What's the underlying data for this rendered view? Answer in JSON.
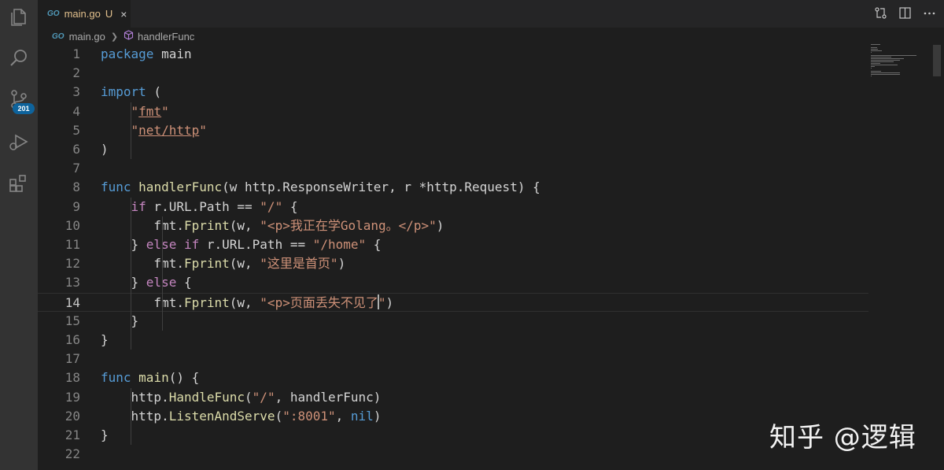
{
  "tab": {
    "icon_text": "GO",
    "title": "main.go",
    "status": "U",
    "close": "×"
  },
  "breadcrumb": {
    "icon_text": "GO",
    "file": "main.go",
    "symbol": "handlerFunc"
  },
  "activity": {
    "scm_badge": "201"
  },
  "colors": {
    "background": "#1e1e1e",
    "activity_bar": "#333333",
    "keyword": "#569cd6",
    "control": "#c586c0",
    "function": "#dcdcaa",
    "string": "#ce9178"
  },
  "editor": {
    "current_line": 14,
    "lines": [
      {
        "n": "1",
        "tokens": [
          {
            "t": "package",
            "c": "kw"
          },
          {
            "t": " main",
            "c": "plain"
          }
        ]
      },
      {
        "n": "2",
        "tokens": []
      },
      {
        "n": "3",
        "tokens": [
          {
            "t": "import",
            "c": "kw"
          },
          {
            "t": " (",
            "c": "plain"
          }
        ]
      },
      {
        "n": "4",
        "tokens": [
          {
            "t": "    ",
            "c": "plain"
          },
          {
            "t": "\"",
            "c": "str"
          },
          {
            "t": "fmt",
            "c": "str ul"
          },
          {
            "t": "\"",
            "c": "str"
          }
        ]
      },
      {
        "n": "5",
        "tokens": [
          {
            "t": "    ",
            "c": "plain"
          },
          {
            "t": "\"",
            "c": "str"
          },
          {
            "t": "net/http",
            "c": "str ul"
          },
          {
            "t": "\"",
            "c": "str"
          }
        ]
      },
      {
        "n": "6",
        "tokens": [
          {
            "t": ")",
            "c": "plain"
          }
        ]
      },
      {
        "n": "7",
        "tokens": []
      },
      {
        "n": "8",
        "tokens": [
          {
            "t": "func",
            "c": "kw"
          },
          {
            "t": " ",
            "c": "plain"
          },
          {
            "t": "handlerFunc",
            "c": "fn"
          },
          {
            "t": "(w http.ResponseWriter, r *http.Request) {",
            "c": "plain"
          }
        ]
      },
      {
        "n": "9",
        "tokens": [
          {
            "t": "    ",
            "c": "plain"
          },
          {
            "t": "if",
            "c": "ctl"
          },
          {
            "t": " r.URL.Path == ",
            "c": "plain"
          },
          {
            "t": "\"/\"",
            "c": "str"
          },
          {
            "t": " {",
            "c": "plain"
          }
        ]
      },
      {
        "n": "10",
        "tokens": [
          {
            "t": "       fmt.",
            "c": "plain"
          },
          {
            "t": "Fprint",
            "c": "fn"
          },
          {
            "t": "(w, ",
            "c": "plain"
          },
          {
            "t": "\"<p>我正在学Golang。</p>\"",
            "c": "str"
          },
          {
            "t": ")",
            "c": "plain"
          }
        ]
      },
      {
        "n": "11",
        "tokens": [
          {
            "t": "    } ",
            "c": "plain"
          },
          {
            "t": "else if",
            "c": "ctl"
          },
          {
            "t": " r.URL.Path == ",
            "c": "plain"
          },
          {
            "t": "\"/home\"",
            "c": "str"
          },
          {
            "t": " {",
            "c": "plain"
          }
        ]
      },
      {
        "n": "12",
        "tokens": [
          {
            "t": "       fmt.",
            "c": "plain"
          },
          {
            "t": "Fprint",
            "c": "fn"
          },
          {
            "t": "(w, ",
            "c": "plain"
          },
          {
            "t": "\"这里是首页\"",
            "c": "str"
          },
          {
            "t": ")",
            "c": "plain"
          }
        ]
      },
      {
        "n": "13",
        "tokens": [
          {
            "t": "    } ",
            "c": "plain"
          },
          {
            "t": "else",
            "c": "ctl"
          },
          {
            "t": " {",
            "c": "plain"
          }
        ]
      },
      {
        "n": "14",
        "tokens": [
          {
            "t": "       fmt.",
            "c": "plain"
          },
          {
            "t": "Fprint",
            "c": "fn"
          },
          {
            "t": "(w, ",
            "c": "plain"
          },
          {
            "t": "\"<p>页面丢失不见了",
            "c": "str"
          },
          {
            "t": "",
            "c": "cursor"
          },
          {
            "t": "\"",
            "c": "str"
          },
          {
            "t": ")",
            "c": "plain"
          }
        ]
      },
      {
        "n": "15",
        "tokens": [
          {
            "t": "    }",
            "c": "plain"
          }
        ]
      },
      {
        "n": "16",
        "tokens": [
          {
            "t": "}",
            "c": "plain"
          }
        ]
      },
      {
        "n": "17",
        "tokens": []
      },
      {
        "n": "18",
        "tokens": [
          {
            "t": "func",
            "c": "kw"
          },
          {
            "t": " ",
            "c": "plain"
          },
          {
            "t": "main",
            "c": "fn"
          },
          {
            "t": "() {",
            "c": "plain"
          }
        ]
      },
      {
        "n": "19",
        "tokens": [
          {
            "t": "    http.",
            "c": "plain"
          },
          {
            "t": "HandleFunc",
            "c": "fn"
          },
          {
            "t": "(",
            "c": "plain"
          },
          {
            "t": "\"/\"",
            "c": "str"
          },
          {
            "t": ", handlerFunc)",
            "c": "plain"
          }
        ]
      },
      {
        "n": "20",
        "tokens": [
          {
            "t": "    http.",
            "c": "plain"
          },
          {
            "t": "ListenAndServe",
            "c": "fn"
          },
          {
            "t": "(",
            "c": "plain"
          },
          {
            "t": "\":8001\"",
            "c": "str"
          },
          {
            "t": ", ",
            "c": "plain"
          },
          {
            "t": "nil",
            "c": "kw"
          },
          {
            "t": ")",
            "c": "plain"
          }
        ]
      },
      {
        "n": "21",
        "tokens": [
          {
            "t": "}",
            "c": "plain"
          }
        ]
      },
      {
        "n": "22",
        "tokens": []
      }
    ]
  },
  "watermark": "知乎 @逻辑"
}
